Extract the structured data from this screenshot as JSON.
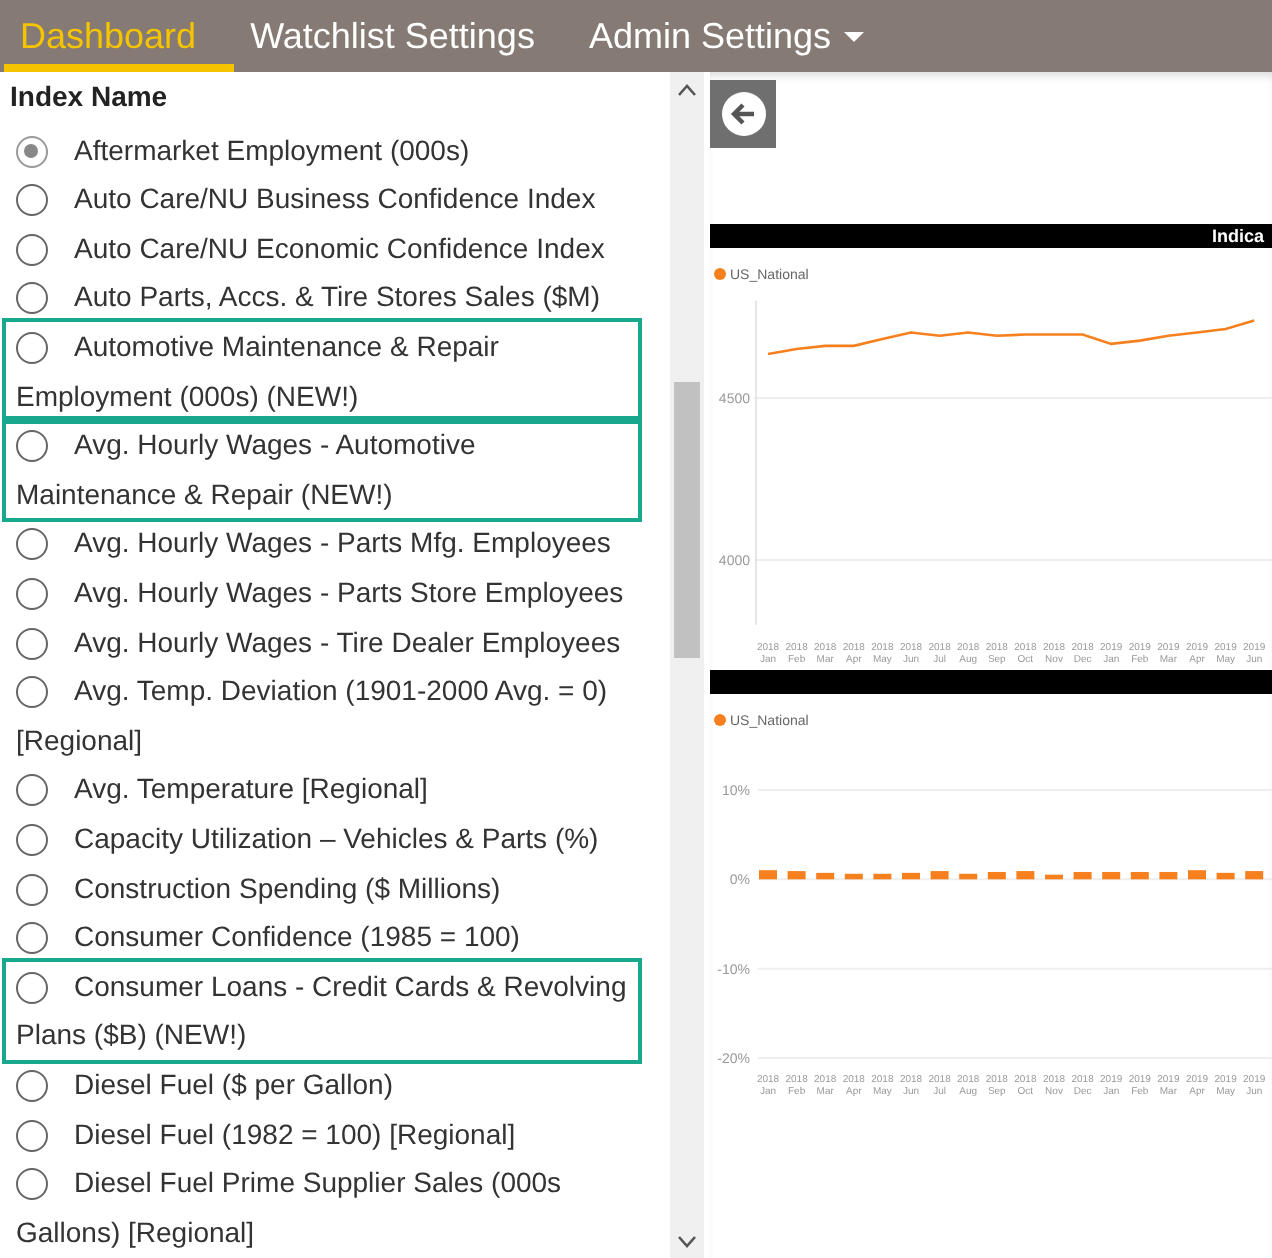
{
  "nav": [
    {
      "label": "Dashboard",
      "selected": true,
      "has_menu": false
    },
    {
      "label": "Watchlist Settings",
      "selected": false,
      "has_menu": false
    },
    {
      "label": "Admin Settings",
      "selected": false,
      "has_menu": true
    }
  ],
  "index_list": {
    "heading": "Index Name",
    "items": [
      {
        "label": "Aftermarket Employment (000s)",
        "selected": true,
        "highlighted": false
      },
      {
        "label": "Auto Care/NU Business Confidence Index",
        "selected": false,
        "highlighted": false
      },
      {
        "label": "Auto Care/NU Economic Confidence Index",
        "selected": false,
        "highlighted": false
      },
      {
        "label": "Auto Parts, Accs. & Tire Stores Sales ($M)",
        "selected": false,
        "highlighted": false
      },
      {
        "label": "Automotive Maintenance & Repair Employment (000s) (NEW!)",
        "selected": false,
        "highlighted": true
      },
      {
        "label": "Avg. Hourly Wages - Automotive Maintenance & Repair (NEW!)",
        "selected": false,
        "highlighted": true
      },
      {
        "label": "Avg. Hourly Wages - Parts Mfg. Employees",
        "selected": false,
        "highlighted": false
      },
      {
        "label": "Avg. Hourly Wages - Parts Store Employees",
        "selected": false,
        "highlighted": false
      },
      {
        "label": "Avg. Hourly Wages - Tire Dealer Employees",
        "selected": false,
        "highlighted": false
      },
      {
        "label": "Avg. Temp. Deviation (1901-2000 Avg. = 0) [Regional]",
        "selected": false,
        "highlighted": false
      },
      {
        "label": "Avg. Temperature [Regional]",
        "selected": false,
        "highlighted": false
      },
      {
        "label": "Capacity Utilization – Vehicles & Parts (%)",
        "selected": false,
        "highlighted": false
      },
      {
        "label": "Construction Spending ($ Millions)",
        "selected": false,
        "highlighted": false
      },
      {
        "label": "Consumer Confidence (1985 = 100)",
        "selected": false,
        "highlighted": false
      },
      {
        "label": "Consumer Loans - Credit Cards & Revolving Plans ($B) (NEW!)",
        "selected": false,
        "highlighted": true
      },
      {
        "label": "Diesel Fuel ($ per Gallon)",
        "selected": false,
        "highlighted": false
      },
      {
        "label": "Diesel Fuel (1982 = 100) [Regional]",
        "selected": false,
        "highlighted": false
      },
      {
        "label": "Diesel Fuel Prime Supplier Sales (000s Gallons) [Regional]",
        "selected": false,
        "highlighted": false
      }
    ]
  },
  "charts": [
    {
      "chart_data": {
        "type": "line",
        "title": "Indica",
        "categories": [
          "2018 Jan",
          "2018 Feb",
          "2018 Mar",
          "2018 Apr",
          "2018 May",
          "2018 Jun",
          "2018 Jul",
          "2018 Aug",
          "2018 Sep",
          "2018 Oct",
          "2018 Nov",
          "2018 Dec",
          "2019 Jan",
          "2019 Feb",
          "2019 Mar",
          "2019 Apr",
          "2019 May",
          "2019 Jun"
        ],
        "ylim": [
          3800,
          4800
        ],
        "yticks": [
          {
            "value": 4000,
            "label": "4000"
          },
          {
            "value": 4500,
            "label": "4500"
          }
        ],
        "series": [
          {
            "name": "US_National",
            "color": "#f7801e",
            "values": [
              4636,
              4651,
              4661,
              4661,
              4682,
              4702,
              4692,
              4702,
              4692,
              4696,
              4696,
              4696,
              4667,
              4677,
              4692,
              4702,
              4713,
              4739
            ]
          }
        ]
      }
    },
    {
      "chart_data": {
        "type": "bar",
        "ylim": [
          -20,
          10
        ],
        "categories": [
          "2018 Jan",
          "2018 Feb",
          "2018 Mar",
          "2018 Apr",
          "2018 May",
          "2018 Jun",
          "2018 Jul",
          "2018 Aug",
          "2018 Sep",
          "2018 Oct",
          "2018 Nov",
          "2018 Dec",
          "2019 Jan",
          "2019 Feb",
          "2019 Mar",
          "2019 Apr",
          "2019 May",
          "2019 Jun"
        ],
        "yticks": [
          {
            "value": -20,
            "label": "-20%"
          },
          {
            "value": -10,
            "label": "-10%"
          },
          {
            "value": 0,
            "label": "0%"
          },
          {
            "value": 10,
            "label": "10%"
          }
        ],
        "series": [
          {
            "name": "US_National",
            "color": "#f7801e",
            "values": [
              0.8,
              0.7,
              0.5,
              0.4,
              0.4,
              0.5,
              0.7,
              0.4,
              0.6,
              0.7,
              0.3,
              0.6,
              0.6,
              0.6,
              0.6,
              0.8,
              0.5,
              0.7
            ]
          }
        ]
      }
    }
  ]
}
